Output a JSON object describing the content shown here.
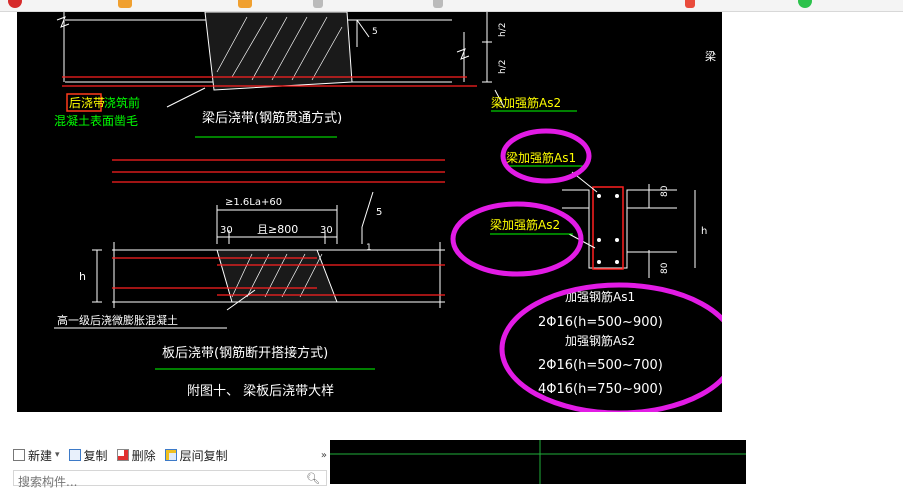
{
  "drawing": {
    "title_beam": "梁后浇带(钢筋贯通方式)",
    "title_slab": "板后浇带(钢筋断开搭接方式)",
    "figure_caption": "附图十、 梁板后浇带大样",
    "label_pour_before": "后浇带",
    "label_pour_before_rest": "浇筑前",
    "label_rough": "混凝土表面凿毛",
    "label_expansion_concrete": "高一级后浇微膨胀混凝土",
    "label_as2_top": "梁加强筋As2",
    "label_as1": "梁加强筋As1",
    "label_as2_mid": "梁加强筋As2",
    "label_right_cut": "梁",
    "dim_lap": "≥1.6La+60",
    "dim_30_left": "30",
    "dim_gap": "且≥800",
    "dim_30_right": "30",
    "dim_slope_5": "5",
    "dim_slope_1": "1",
    "dim_top_5": "5",
    "dim_h": "h",
    "dim_h_right": "h",
    "dim_h2_a": "h/2",
    "dim_h2_b": "h/2",
    "dim_80_top": "80",
    "dim_80_bot": "80",
    "note_as1_title": "加强钢筋As1",
    "note_as1_line": "2Φ16(h=500~900)",
    "note_as2_title": "加强钢筋As2",
    "note_as2_line1": "2Φ16(h=500~700)",
    "note_as2_line2": "4Φ16(h=750~900)"
  },
  "toolbar": {
    "new_label": "新建",
    "copy_label": "复制",
    "delete_label": "删除",
    "floor_copy_label": "层间复制",
    "more_label": "»"
  },
  "search": {
    "placeholder": "搜索构件..."
  },
  "colors": {
    "annotation_circle": "#e21be5",
    "cad_background": "#000000",
    "rebar_red": "#ff2020",
    "label_green": "#00ff00",
    "label_yellow": "#ffff00"
  }
}
